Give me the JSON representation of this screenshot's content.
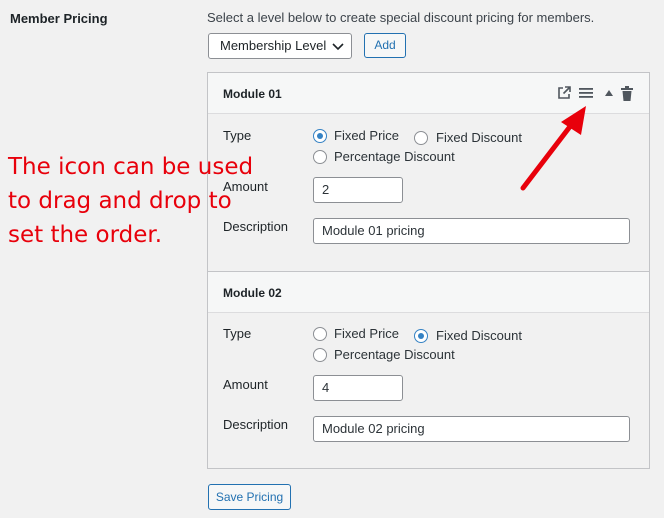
{
  "field_label": "Member Pricing",
  "intro": "Select a level below to create special discount pricing for members.",
  "membership_select": {
    "value": "Membership Level"
  },
  "add_label": "Add",
  "save_label": "Save Pricing",
  "labels": {
    "type": "Type",
    "amount": "Amount",
    "description": "Description"
  },
  "radio_options": {
    "fixed_price": "Fixed Price",
    "fixed_discount": "Fixed Discount",
    "percentage_discount": "Percentage Discount"
  },
  "modules": [
    {
      "title": "Module 01",
      "type_selected": "Fixed Price",
      "amount": "2",
      "description": "Module 01 pricing"
    },
    {
      "title": "Module 02",
      "type_selected": "Fixed Discount",
      "amount": "4",
      "description": "Module 02 pricing"
    }
  ],
  "tool_icons": [
    "external-link-icon",
    "drag-handle-icon",
    "collapse-triangle-icon",
    "trash-icon"
  ],
  "annotation": {
    "lines": [
      "The icon can be used",
      "to drag and drop to",
      "set the order."
    ],
    "color": "#e8000b"
  },
  "colors": {
    "accent": "#2271b1",
    "radio": "#3582c4"
  }
}
